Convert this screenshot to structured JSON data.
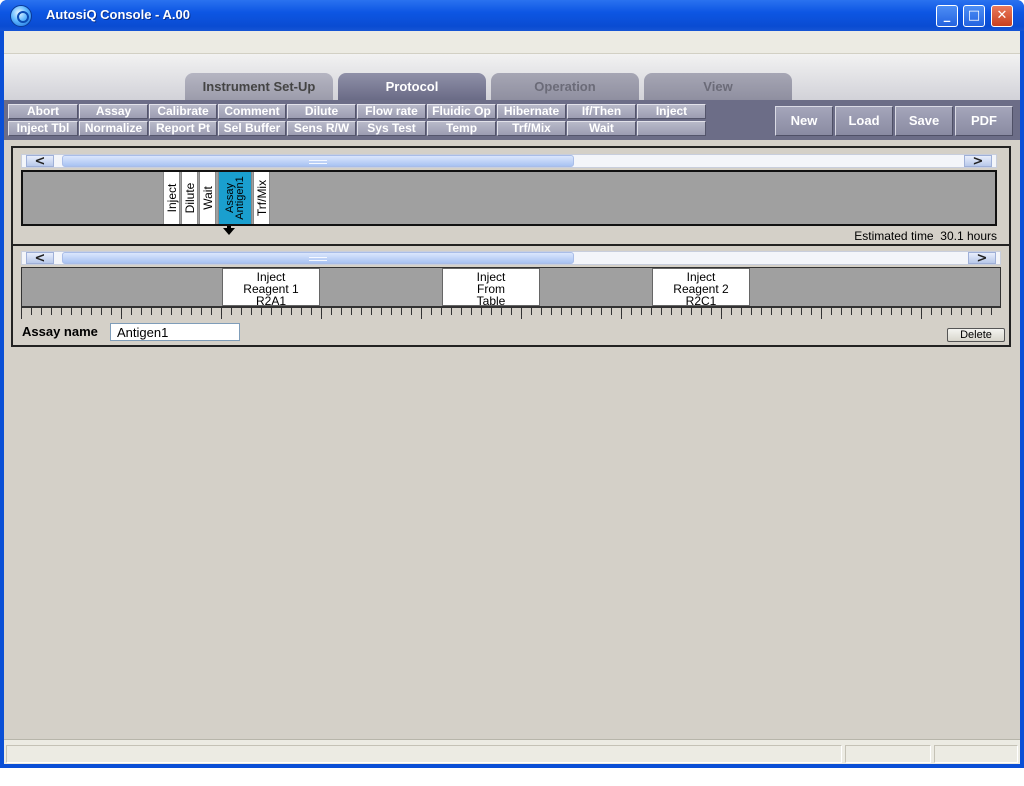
{
  "window": {
    "title": "AutosiQ Console - A.00",
    "minimize_glyph": "_",
    "maximize_glyph": "□",
    "close_glyph": "✕"
  },
  "tabs": [
    {
      "label": "Instrument Set-Up",
      "state": "inactive"
    },
    {
      "label": "Protocol",
      "state": "active"
    },
    {
      "label": "Operation",
      "state": "disabled"
    },
    {
      "label": "View",
      "state": "disabled"
    }
  ],
  "toolbar": {
    "row1": [
      "Abort",
      "Assay",
      "Calibrate",
      "Comment",
      "Dilute",
      "Flow rate",
      "Fluidic Op",
      "Hibernate",
      "If/Then",
      "Inject"
    ],
    "row2": [
      "Inject Tbl",
      "Normalize",
      "Report Pt",
      "Sel Buffer",
      "Sens R/W",
      "Sys Test",
      "Temp",
      "Trf/Mix",
      "Wait"
    ],
    "actions": [
      "New",
      "Load",
      "Save",
      "PDF"
    ]
  },
  "protocol": {
    "scroll_left": "<",
    "scroll_right": ">",
    "steps": [
      {
        "label": "Inject",
        "selected": false
      },
      {
        "label": "Dilute",
        "selected": false
      },
      {
        "label": "Wait",
        "selected": false
      },
      {
        "label": "Assay\nAntigen1",
        "selected": true
      },
      {
        "label": "Trf/Mix",
        "selected": false
      }
    ],
    "estimated_time_label": "Estimated time",
    "estimated_time_value": "30.1 hours"
  },
  "assay": {
    "scroll_left": "<",
    "scroll_right": ">",
    "steps": [
      {
        "lines": [
          "Inject",
          "Reagent 1",
          "R2A1"
        ]
      },
      {
        "lines": [
          "Inject",
          "From",
          "Table"
        ]
      },
      {
        "lines": [
          "Inject",
          "Reagent 2",
          "R2C1"
        ]
      }
    ],
    "name_label": "Assay name",
    "name_value": "Antigen1",
    "delete_label": "Delete"
  },
  "colors": {
    "selected_step": "#1a9fcf",
    "toolbar_bg": "#6c6d87",
    "titlebar": "#0a4cd2"
  }
}
